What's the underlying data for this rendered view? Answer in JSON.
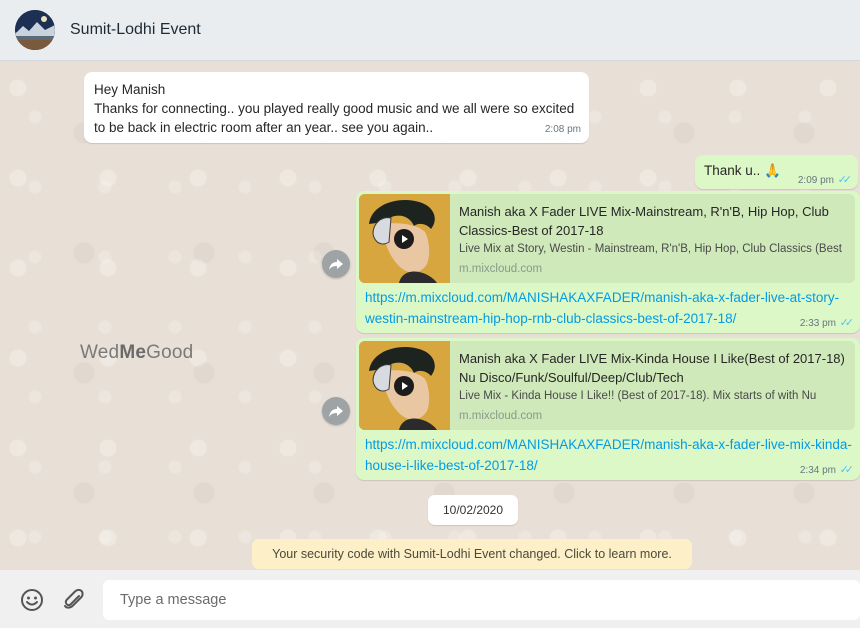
{
  "header": {
    "contact_name": "Sumit-Lodhi Event"
  },
  "messages": {
    "incoming": {
      "lines": [
        "Hey Manish",
        "Thanks for connecting.. you played really good music and we all were so excited",
        "to be back in electric room after an year.. see you again.."
      ],
      "time": "2:08 pm"
    },
    "reply": {
      "text": "Thank u.. 🙏",
      "time": "2:09 pm"
    },
    "links": [
      {
        "title": "Manish aka X Fader LIVE Mix-Mainstream, R'n'B, Hip Hop, Club Classics-Best of 2017-18",
        "description": "Live Mix at Story, Westin - Mainstream, R'n'B, Hip Hop, Club Classics (Best",
        "domain": "m.mixcloud.com",
        "url": "https://m.mixcloud.com/MANISHAKAXFADER/manish-aka-x-fader-live-at-story-westin-mainstream-hip-hop-rnb-club-classics-best-of-2017-18/",
        "time": "2:33 pm"
      },
      {
        "title": "Manish aka X Fader LIVE Mix-Kinda House I Like(Best of 2017-18) Nu Disco/Funk/Soulful/Deep/Club/Tech",
        "description": "Live Mix - Kinda House I Like!! (Best of 2017-18). Mix starts of with Nu",
        "domain": "m.mixcloud.com",
        "url": "https://m.mixcloud.com/MANISHAKAXFADER/manish-aka-x-fader-live-mix-kinda-house-i-like-best-of-2017-18/",
        "time": "2:34 pm"
      }
    ]
  },
  "watermark": {
    "part1": "Wed",
    "part2": "Me",
    "part3": "Good"
  },
  "date_chip": "10/02/2020",
  "security_notice": "Your security code with Sumit-Lodhi Event changed. Click to learn more.",
  "composer": {
    "placeholder": "Type a message"
  },
  "icons": {
    "emoji": "smiley-icon",
    "attach": "paperclip-icon",
    "share": "forward-icon",
    "read": "double-check-icon"
  },
  "colors": {
    "outgoing_bubble": "#dcf8c6",
    "link": "#039be5",
    "read_ticks": "#4fc3f7",
    "security_bg": "#fdf0c8"
  }
}
